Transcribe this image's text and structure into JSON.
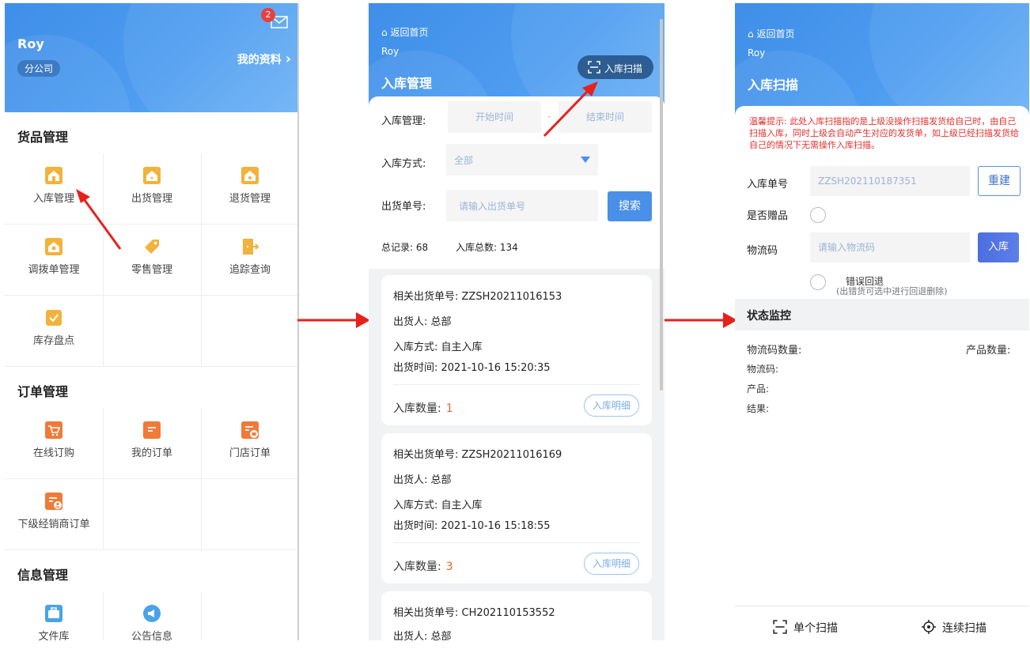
{
  "panel1": {
    "user_name": "Roy",
    "branch": "分公司",
    "my_profile": "我的资料",
    "my_profile_chevron": "›",
    "mail_count": "2",
    "sections": [
      {
        "title": "货品管理",
        "items": [
          "入库管理",
          "出货管理",
          "退货管理",
          "调拨单管理",
          "零售管理",
          "追踪查询",
          "库存盘点"
        ]
      },
      {
        "title": "订单管理",
        "items": [
          "在线订购",
          "我的订单",
          "门店订单",
          "下级经销商订单"
        ]
      },
      {
        "title": "信息管理",
        "items": [
          "文件库",
          "公告信息"
        ]
      }
    ]
  },
  "panel2": {
    "back_home": "返回首页",
    "user_name": "Roy",
    "title": "入库管理",
    "scan_button": "入库扫描",
    "filter": {
      "date_label": "入库管理:",
      "start_placeholder": "开始时间",
      "dash": "-",
      "end_placeholder": "结束时间",
      "method_label": "入库方式:",
      "method_value": "全部",
      "order_label": "出货单号:",
      "order_placeholder": "请输入出货单号",
      "search_button": "搜索",
      "total_records": "总记录: 68",
      "total_in": "入库总数: 134"
    },
    "cards": [
      {
        "order": "相关出货单号: ZZSH20211016153",
        "shipper": "出货人: 总部",
        "method": "入库方式: 自主入库",
        "time": "出货时间: 2021-10-16 15:20:35",
        "qty_label": "入库数量:",
        "qty": "1",
        "detail": "入库明细"
      },
      {
        "order": "相关出货单号: ZZSH20211016169",
        "shipper": "出货人: 总部",
        "method": "入库方式: 自主入库",
        "time": "出货时间: 2021-10-16 15:18:55",
        "qty_label": "入库数量:",
        "qty": "3",
        "detail": "入库明细"
      },
      {
        "order": "相关出货单号: CH202110153552",
        "shipper": "出货人: 总部"
      }
    ]
  },
  "panel3": {
    "back_home": "返回首页",
    "user_name": "Roy",
    "title": "入库扫描",
    "tip": "温馨提示: 此处入库扫描指的是上级没操作扫描发货给自己时，由自己扫描入库，同时上级会自动产生对应的发货单，如上级已经扫描发货给自己的情况下无需操作入库扫描。",
    "receipt_label": "入库单号",
    "receipt_placeholder": "ZZSH202110187351",
    "rebuild_button": "重建",
    "gift_label": "是否赠品",
    "logistics_label": "物流码",
    "logistics_placeholder": "请输入物流码",
    "store_button": "入库",
    "return_label": "错误回退",
    "return_hint": "(出错货可选中进行回退删除)",
    "monitor_title": "状态监控",
    "code_count": "物流码数量:",
    "product_count": "产品数量:",
    "code": "物流码:",
    "product": "产品:",
    "result": "结果:",
    "single_scan": "单个扫描",
    "continuous_scan": "连续扫描"
  },
  "colors": {
    "header_blue": "#4d9cf0",
    "arrow_red": "#e8201c",
    "icon_yellow": "#f2b23b",
    "icon_orange": "#f07a38",
    "icon_blue": "#4aa3e8"
  }
}
